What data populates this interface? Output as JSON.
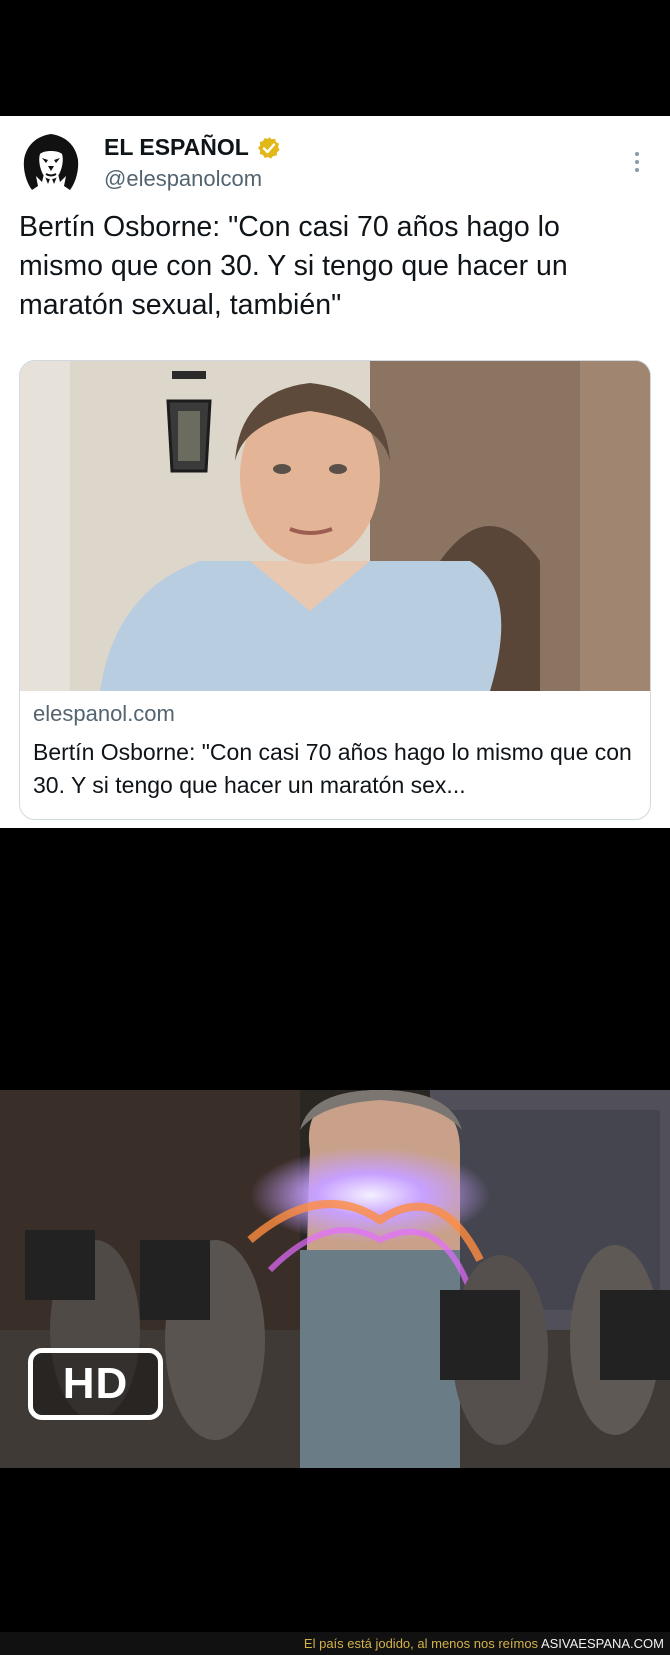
{
  "tweet": {
    "author_name": "EL ESPAÑOL",
    "author_handle": "@elespanolcom",
    "text": "Bertín Osborne: \"Con casi 70 años hago lo mismo que con 30. Y si tengo que hacer un maratón sexual, también\"",
    "avatar_icon": "lion-logo-icon",
    "verified_icon": "verified-badge-icon",
    "more_icon": "more-options-icon",
    "verified_color": "#e2b719"
  },
  "card": {
    "domain": "elespanol.com",
    "title": "Bertín Osborne: \"Con casi 70 años hago lo mismo que con 30. Y si tengo que hacer un maratón sex..."
  },
  "meme": {
    "badge": "HD"
  },
  "footer": {
    "caption": "El país está jodido, al menos nos reímos ",
    "site": "ASIVAESPANA.COM"
  }
}
